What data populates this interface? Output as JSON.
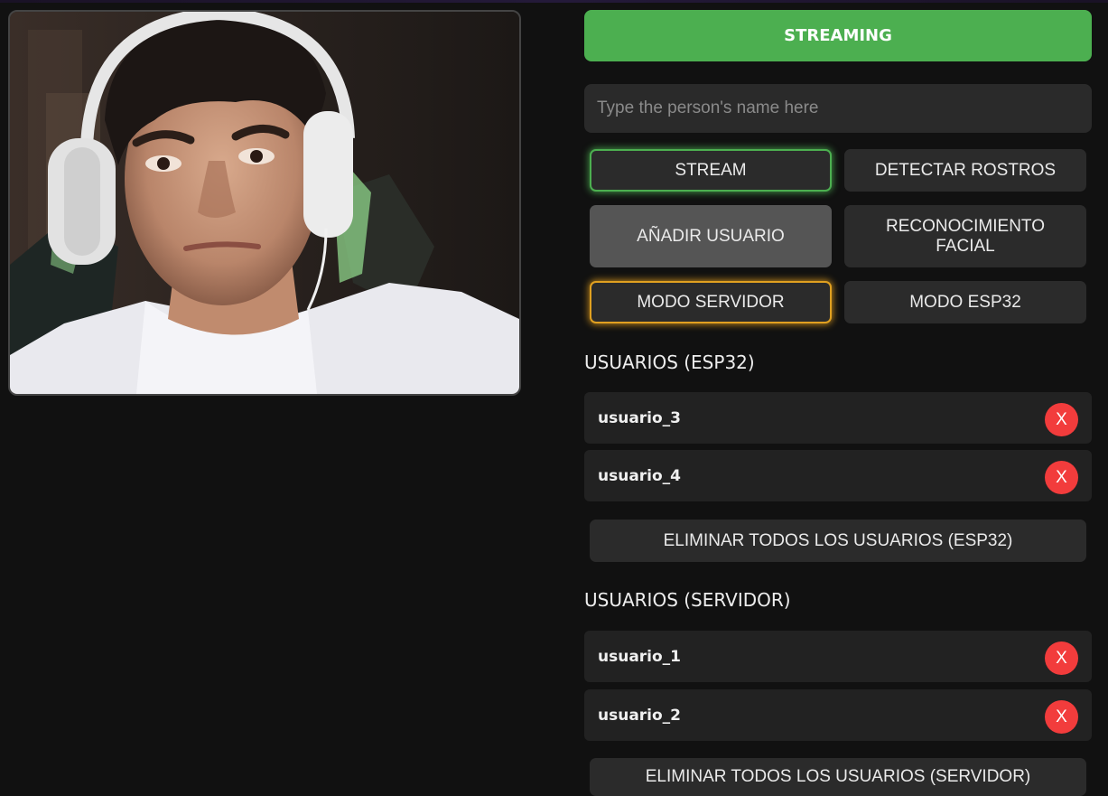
{
  "status_button": {
    "label": "STREAMING",
    "color": "#4caf50"
  },
  "name_input": {
    "placeholder": "Type the person's name here",
    "value": ""
  },
  "controls": {
    "stream": "STREAM",
    "detect_faces": "DETECTAR ROSTROS",
    "add_user": "AÑADIR USUARIO",
    "face_recognition": "RECONOCIMIENTO FACIAL",
    "server_mode": "MODO SERVIDOR",
    "esp32_mode": "MODO ESP32"
  },
  "esp32_users": {
    "title": "USUARIOS (ESP32)",
    "items": [
      {
        "name": "usuario_3",
        "delete_label": "X"
      },
      {
        "name": "usuario_4",
        "delete_label": "X"
      }
    ],
    "clear_all_label": "ELIMINAR TODOS LOS USUARIOS (ESP32)"
  },
  "server_users": {
    "title": "USUARIOS (SERVIDOR)",
    "items": [
      {
        "name": "usuario_1",
        "delete_label": "X"
      },
      {
        "name": "usuario_2",
        "delete_label": "X"
      }
    ],
    "clear_all_label": "ELIMINAR TODOS LOS USUARIOS (SERVIDOR)"
  },
  "colors": {
    "background": "#111111",
    "active_stream": "#4caf50",
    "active_mode": "#e0a020",
    "delete": "#f23c3c"
  },
  "icons": {
    "delete": "close-icon"
  }
}
